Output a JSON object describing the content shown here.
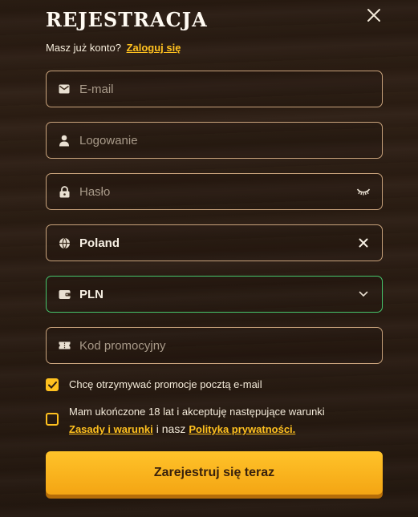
{
  "modal": {
    "title": "REJESTRACJA",
    "have_account_text": "Masz już konto?",
    "login_link": "Zaloguj się"
  },
  "fields": {
    "email_placeholder": "E-mail",
    "login_placeholder": "Logowanie",
    "password_placeholder": "Hasło",
    "country_value": "Poland",
    "currency_value": "PLN",
    "promo_placeholder": "Kod promocyjny"
  },
  "checkboxes": {
    "newsletter_label": "Chcę otrzymywać promocje pocztą e-mail",
    "newsletter_checked": true,
    "terms_label": "Mam ukończone 18 lat i akceptuję następujące warunki",
    "terms_checked": false,
    "terms_link": "Zasady i warunki",
    "terms_connector": "i nasz",
    "privacy_link": "Polityka prywatności."
  },
  "submit_label": "Zarejestruj się teraz",
  "icons": {
    "close": "close-icon",
    "email": "envelope-icon",
    "login": "user-icon",
    "password": "lock-icon",
    "password_toggle": "eye-closed-icon",
    "country": "globe-icon",
    "country_clear": "clear-icon",
    "currency": "wallet-icon",
    "currency_dropdown": "chevron-down-icon",
    "promo": "ticket-icon",
    "check": "check-icon"
  },
  "colors": {
    "accent": "#ffc11f",
    "field_border": "#c9a37c",
    "active_border": "#46c66c",
    "button_text": "#3a220c"
  }
}
